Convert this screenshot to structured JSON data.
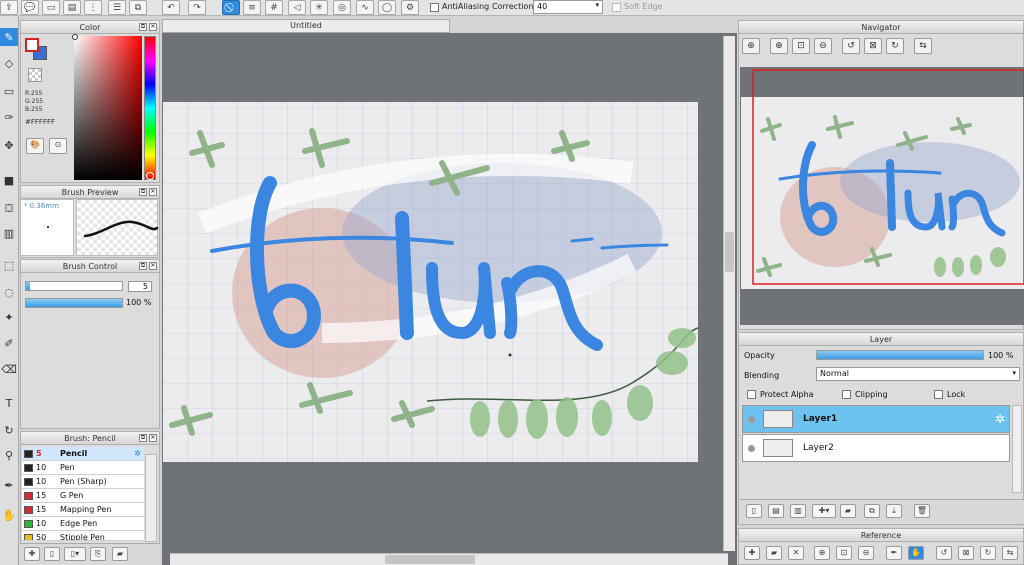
{
  "toolbar": {
    "antialiasing_label": "AntiAliasing",
    "correction_label": "Correction",
    "correction_value": "40",
    "soft_edge_label": "Soft Edge"
  },
  "document": {
    "title": "Untitled"
  },
  "color_panel": {
    "title": "Color",
    "r": "R:255",
    "g": "G:255",
    "b": "B:255",
    "hex": "#FFFFFF",
    "main_color": "#d42020",
    "sub_color": "#3b6fd8"
  },
  "brush_preview": {
    "title": "Brush Preview",
    "size_label": "* 0.36mm"
  },
  "brush_control": {
    "title": "Brush Control",
    "size_value": "5",
    "opacity_value": "100 %",
    "size_fraction": 0.04,
    "opacity_fraction": 1.0
  },
  "brush_list": {
    "title": "Brush: Pencil",
    "items": [
      {
        "size": "5",
        "name": "Pencil",
        "color": "#222222"
      },
      {
        "size": "10",
        "name": "Pen",
        "color": "#222222"
      },
      {
        "size": "10",
        "name": "Pen (Sharp)",
        "color": "#222222"
      },
      {
        "size": "15",
        "name": "G Pen",
        "color": "#d92b2b"
      },
      {
        "size": "15",
        "name": "Mapping Pen",
        "color": "#d92b2b"
      },
      {
        "size": "10",
        "name": "Edge Pen",
        "color": "#2fb52f"
      },
      {
        "size": "50",
        "name": "Stipple Pen",
        "color": "#e0c020"
      }
    ]
  },
  "navigator": {
    "title": "Navigator"
  },
  "layer_panel": {
    "title": "Layer",
    "opacity_label": "Opacity",
    "opacity_value": "100 %",
    "opacity_fraction": 1.0,
    "blending_label": "Blending",
    "blending_value": "Normal",
    "protect_alpha_label": "Protect Alpha",
    "clipping_label": "Clipping",
    "lock_label": "Lock",
    "layers": [
      {
        "name": "Layer1",
        "selected": true
      },
      {
        "name": "Layer2",
        "selected": false
      }
    ]
  },
  "reference": {
    "title": "Reference"
  },
  "artwork": {
    "lettering": "bun"
  },
  "colors": {
    "accent": "#2f8ae0",
    "lettering": "#3a86e0",
    "leaf": "#7fae6c"
  }
}
